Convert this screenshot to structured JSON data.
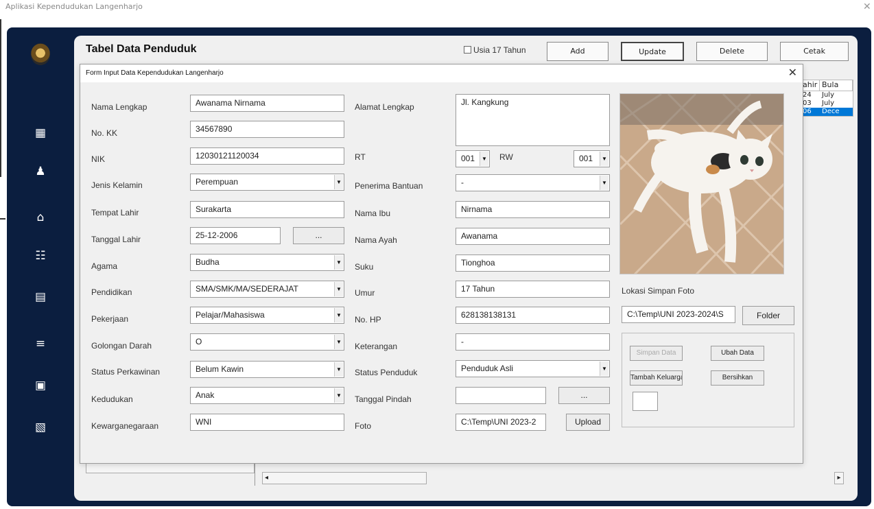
{
  "app": {
    "title": "Aplikasi Kependudukan Langenharjo"
  },
  "sidebar": {
    "icons": [
      "logo-icon",
      "dashboard-icon",
      "people-icon",
      "home-icon",
      "group-icon",
      "document-icon",
      "database-icon",
      "save-icon",
      "report-icon"
    ]
  },
  "table": {
    "title": "Tabel Data Penduduk",
    "filter_label": "Usia 17 Tahun",
    "buttons": {
      "add": "Add",
      "update": "Update",
      "delete": "Delete",
      "print": "Cetak"
    },
    "columns": [
      "ahir",
      "Bula"
    ],
    "rows": [
      {
        "c1": "24",
        "c2": "July"
      },
      {
        "c1": "03",
        "c2": "July"
      },
      {
        "c1": "06",
        "c2": "Dece"
      }
    ]
  },
  "form": {
    "title": "Form Input Data Kependudukan Langenharjo",
    "left_fields": [
      {
        "label": "Nama Lengkap",
        "value": "Awanama Nirnama",
        "type": "text"
      },
      {
        "label": "No. KK",
        "value": "34567890",
        "type": "text"
      },
      {
        "label": "NIK",
        "value": "12030121120034",
        "type": "text"
      },
      {
        "label": "Jenis Kelamin",
        "value": "Perempuan",
        "type": "combo"
      },
      {
        "label": "Tempat Lahir",
        "value": "Surakarta",
        "type": "text"
      },
      {
        "label": "Tanggal Lahir",
        "value": "25-12-2006",
        "type": "date"
      },
      {
        "label": "Agama",
        "value": "Budha",
        "type": "combo"
      },
      {
        "label": "Pendidikan",
        "value": "SMA/SMK/MA/SEDERAJAT",
        "type": "combo"
      },
      {
        "label": "Pekerjaan",
        "value": "Pelajar/Mahasiswa",
        "type": "combo"
      },
      {
        "label": "Golongan Darah",
        "value": "O",
        "type": "combo"
      },
      {
        "label": "Status Perkawinan",
        "value": "Belum Kawin",
        "type": "combo"
      },
      {
        "label": "Kedudukan",
        "value": "Anak",
        "type": "combo"
      },
      {
        "label": "Kewarganegaraan",
        "value": "WNI",
        "type": "text"
      }
    ],
    "right_fields": {
      "alamat": {
        "label": "Alamat Lengkap",
        "value": "Jl. Kangkung"
      },
      "rt": {
        "label": "RT",
        "value": "001"
      },
      "rw": {
        "label": "RW",
        "value": "001"
      },
      "penerima_bantuan": {
        "label": "Penerima Bantuan",
        "value": "-"
      },
      "nama_ibu": {
        "label": "Nama Ibu",
        "value": "Nirnama"
      },
      "nama_ayah": {
        "label": "Nama Ayah",
        "value": "Awanama"
      },
      "suku": {
        "label": "Suku",
        "value": "Tionghoa"
      },
      "umur": {
        "label": "Umur",
        "value": "17 Tahun"
      },
      "no_hp": {
        "label": "No. HP",
        "value": "628138138131"
      },
      "keterangan": {
        "label": "Keterangan",
        "value": "-"
      },
      "status_penduduk": {
        "label": "Status Penduduk",
        "value": "Penduduk Asli"
      },
      "tanggal_pindah": {
        "label": "Tanggal Pindah",
        "value": ""
      },
      "foto": {
        "label": "Foto",
        "value": "C:\\Temp\\UNI 2023-2"
      }
    },
    "date_picker_label": "...",
    "upload_label": "Upload",
    "photo_location": {
      "label": "Lokasi Simpan Foto",
      "value": "C:\\Temp\\UNI 2023-2024\\S"
    },
    "folder_label": "Folder",
    "actions": {
      "save": "Simpan Data",
      "edit": "Ubah Data",
      "add_family": "Tambah Keluarga",
      "clear": "Bersihkan"
    }
  }
}
